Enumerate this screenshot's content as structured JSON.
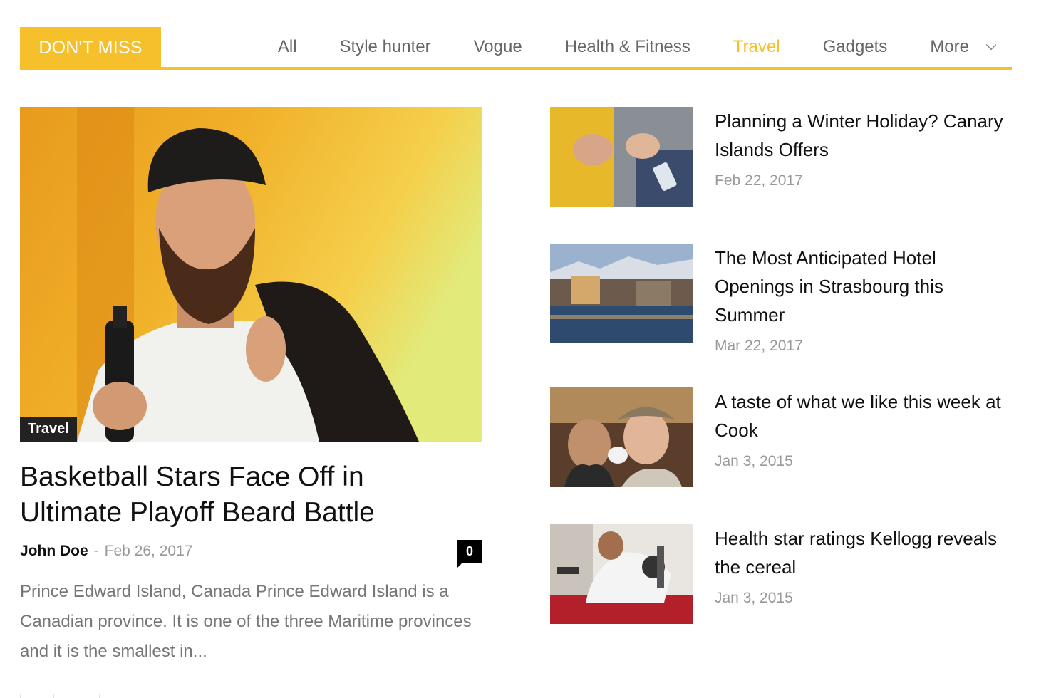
{
  "header": {
    "title": "DON'T MISS",
    "filters": [
      "All",
      "Style hunter",
      "Vogue",
      "Health & Fitness",
      "Travel",
      "Gadgets",
      "More"
    ],
    "active_filter": "Travel"
  },
  "feature": {
    "category": "Travel",
    "title": "Basketball Stars Face Off in Ultimate Playoff Beard Battle",
    "author": "John Doe",
    "separator": "-",
    "date": "Feb 26, 2017",
    "comments": "0",
    "excerpt": "Prince Edward Island, Canada Prince Edward Island is a Canadian province. It is one of the three Maritime provinces and it is the smallest in..."
  },
  "side_articles": [
    {
      "title": "Planning a Winter Holiday? Canary Islands Offers",
      "date": "Feb 22, 2017"
    },
    {
      "title": "The Most Anticipated Hotel Openings in Strasbourg this Summer",
      "date": "Mar 22, 2017"
    },
    {
      "title": "A taste of what we like this week at Cook",
      "date": "Jan 3, 2015"
    },
    {
      "title": "Health star ratings Kellogg reveals the cereal",
      "date": "Jan 3, 2015"
    }
  ],
  "colors": {
    "accent": "#f6c02d",
    "badge_bg": "#222222",
    "meta_gray": "#999999"
  },
  "icons": {
    "more": "chevron-down-icon"
  }
}
